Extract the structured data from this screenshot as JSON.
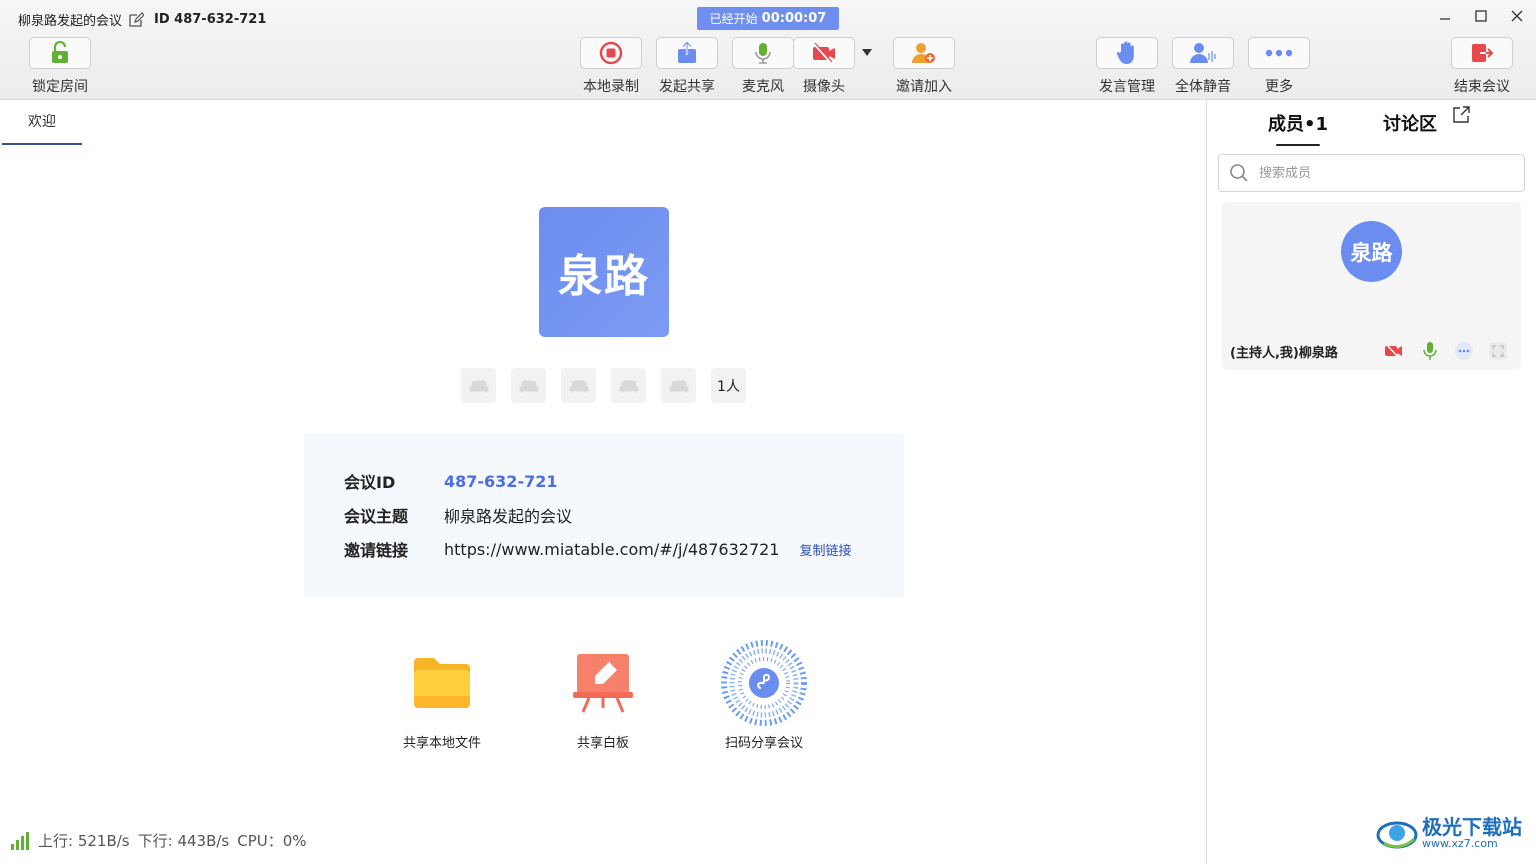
{
  "window": {
    "title": "柳泉路发起的会议",
    "meeting_id_label": "ID 487-632-721",
    "timer_prefix": "已经开始",
    "timer_value": "00:00:07",
    "minimize_glyph": "—",
    "maximize_glyph": "☐",
    "close_glyph": "✕"
  },
  "toolbar": {
    "lock_room": "锁定房间",
    "local_record": "本地录制",
    "start_share": "发起共享",
    "microphone": "麦克风",
    "camera": "摄像头",
    "invite": "邀请加入",
    "speak_manage": "发言管理",
    "mute_all": "全体静音",
    "more": "更多",
    "end_meeting": "结束会议"
  },
  "main": {
    "tab_welcome": "欢迎",
    "avatar_text": "泉路",
    "seat_count": "1人",
    "info": {
      "id_label": "会议ID",
      "id_value": "487-632-721",
      "topic_label": "会议主题",
      "topic_value": "柳泉路发起的会议",
      "link_label": "邀请链接",
      "link_value": "https://www.miatable.com/#/j/487632721",
      "copy_link": "复制链接"
    },
    "actions": {
      "share_file": "共享本地文件",
      "share_whiteboard": "共享白板",
      "scan_share": "扫码分享会议"
    },
    "status": {
      "upload": "上行: 521B/s",
      "download": "下行: 443B/s",
      "cpu": "CPU：0%"
    }
  },
  "side": {
    "tab_members": "成员•1",
    "tab_discussion": "讨论区",
    "search_placeholder": "搜索成员",
    "member": {
      "avatar_text": "泉路",
      "name": "(主持人,我)柳泉路"
    }
  },
  "watermark": {
    "line1": "极光下载站",
    "line2": "www.xz7.com"
  },
  "colors": {
    "accent": "#6c8df0",
    "link": "#4a6fe0",
    "record_red": "#e8474b",
    "mic_green": "#5fb233"
  }
}
